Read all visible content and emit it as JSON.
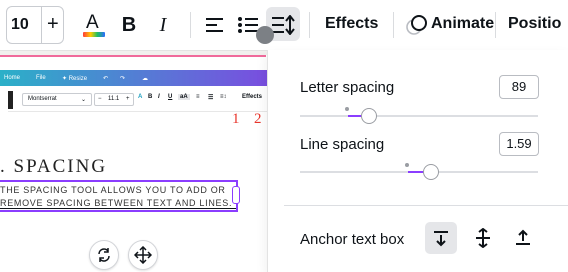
{
  "toolbar": {
    "font_size": "10",
    "plus": "+",
    "bold": "B",
    "italic": "I",
    "effects_label": "Effects",
    "animate_label": "Animate",
    "position_label": "Positio"
  },
  "canvas": {
    "mini_toolbar": {
      "home": "Home",
      "file": "File",
      "resize": "✦ Resize",
      "font": "Montserrat",
      "size": "11.1",
      "effects": "Effects"
    },
    "annotations": [
      "1",
      "2"
    ],
    "heading": "SPACING",
    "body_line1": "THE SPACING TOOL ALLOWS YOU TO ADD OR",
    "body_line2": "REMOVE SPACING BETWEEN TEXT AND LINES."
  },
  "panel": {
    "letter_spacing_label": "Letter spacing",
    "letter_spacing_value": "89",
    "line_spacing_label": "Line spacing",
    "line_spacing_value": "1.59",
    "anchor_label": "Anchor text box"
  },
  "colors": {
    "accent": "#8b3dff",
    "pink_guide": "#f06a9b",
    "annotation_red": "#e8352c"
  }
}
